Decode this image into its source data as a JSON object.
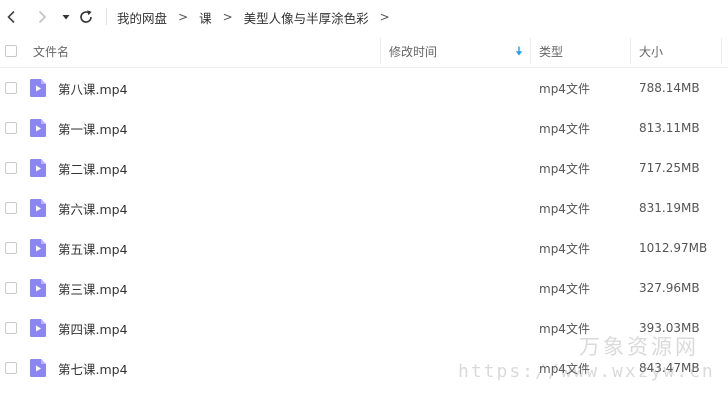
{
  "toolbar": {
    "back_icon": "chevron-left-icon",
    "forward_icon": "chevron-right-icon",
    "history_icon": "caret-down-icon",
    "refresh_icon": "refresh-icon"
  },
  "breadcrumb": {
    "items": [
      "我的网盘",
      "课",
      "美型人像与半厚涂色彩"
    ],
    "separator": ">"
  },
  "table": {
    "columns": {
      "name": "文件名",
      "modified": "修改时间",
      "type": "类型",
      "size": "大小"
    },
    "sort_icon": "sort-down-arrow-icon",
    "sort_color": "#1e9fe8"
  },
  "files": [
    {
      "name": "第八课.mp4",
      "type": "mp4文件",
      "size": "788.14MB"
    },
    {
      "name": "第一课.mp4",
      "type": "mp4文件",
      "size": "813.11MB"
    },
    {
      "name": "第二课.mp4",
      "type": "mp4文件",
      "size": "717.25MB"
    },
    {
      "name": "第六课.mp4",
      "type": "mp4文件",
      "size": "831.19MB"
    },
    {
      "name": "第五课.mp4",
      "type": "mp4文件",
      "size": "1012.97MB"
    },
    {
      "name": "第三课.mp4",
      "type": "mp4文件",
      "size": "327.96MB"
    },
    {
      "name": "第四课.mp4",
      "type": "mp4文件",
      "size": "393.03MB"
    },
    {
      "name": "第七课.mp4",
      "type": "mp4文件",
      "size": "843.47MB"
    }
  ],
  "file_icon": {
    "name": "video-file-icon",
    "color": "#8c86f2"
  },
  "watermark": {
    "title": "万象资源网",
    "url": "https://www.wxzyw.cn"
  }
}
